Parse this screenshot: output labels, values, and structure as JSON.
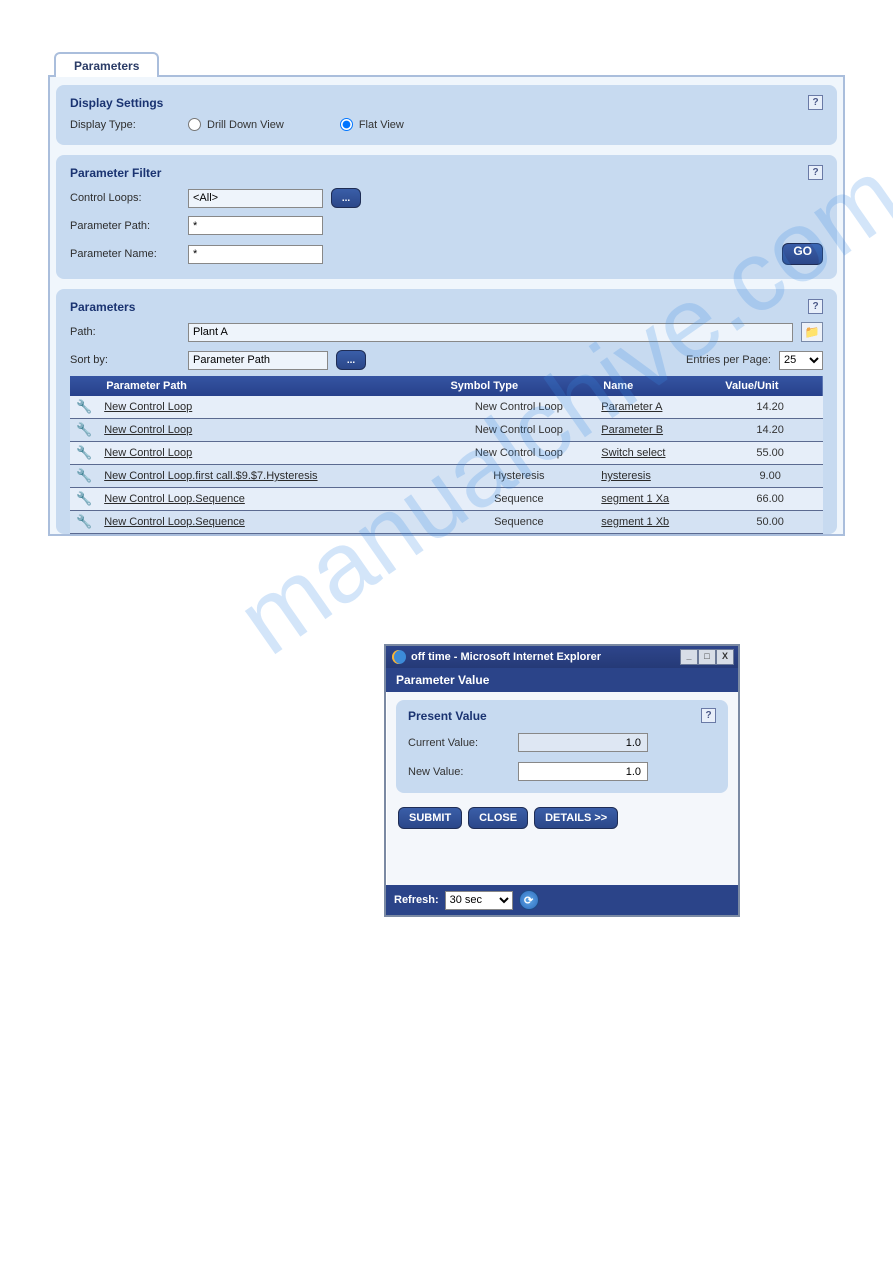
{
  "tab_label": "Parameters",
  "display_settings": {
    "title": "Display Settings",
    "display_type_label": "Display Type:",
    "drill_label": "Drill Down View",
    "flat_label": "Flat View",
    "selected": "flat"
  },
  "filter": {
    "title": "Parameter Filter",
    "control_loops_label": "Control Loops:",
    "control_loops_value": "<All>",
    "param_path_label": "Parameter Path:",
    "param_path_value": "*",
    "param_name_label": "Parameter Name:",
    "param_name_value": "*",
    "browse_label": "...",
    "go_label": "GO"
  },
  "params_section": {
    "title": "Parameters",
    "path_label": "Path:",
    "path_value": "Plant A",
    "sort_label": "Sort by:",
    "sort_value": "Parameter Path",
    "browse_label": "...",
    "entries_label": "Entries per Page:",
    "entries_value": "25",
    "columns": {
      "path": "Parameter Path",
      "symbol": "Symbol Type",
      "name": "Name",
      "value": "Value/Unit"
    },
    "rows": [
      {
        "path": "New Control Loop",
        "symbol": "New Control Loop",
        "name": "Parameter A",
        "value": "14.20"
      },
      {
        "path": "New Control Loop",
        "symbol": "New Control Loop",
        "name": "Parameter B",
        "value": "14.20"
      },
      {
        "path": "New Control Loop",
        "symbol": "New Control Loop",
        "name": "Switch select",
        "value": "55.00"
      },
      {
        "path": "New Control Loop.first call.$9.$7.Hysteresis",
        "symbol": "Hysteresis",
        "name": "hysteresis",
        "value": "9.00"
      },
      {
        "path": "New Control Loop.Sequence",
        "symbol": "Sequence",
        "name": "segment 1 Xa",
        "value": "66.00"
      },
      {
        "path": "New Control Loop.Sequence",
        "symbol": "Sequence",
        "name": "segment 1 Xb",
        "value": "50.00"
      }
    ]
  },
  "dialog": {
    "window_title": "off time - Microsoft Internet Explorer",
    "subhead": "Parameter Value",
    "pv_title": "Present Value",
    "current_label": "Current Value:",
    "current_value": "1.0",
    "new_label": "New Value:",
    "new_value": "1.0",
    "submit": "SUBMIT",
    "close": "CLOSE",
    "details": "DETAILS >>",
    "refresh_label": "Refresh:",
    "refresh_value": "30 sec"
  },
  "watermark": "manualchive.com"
}
